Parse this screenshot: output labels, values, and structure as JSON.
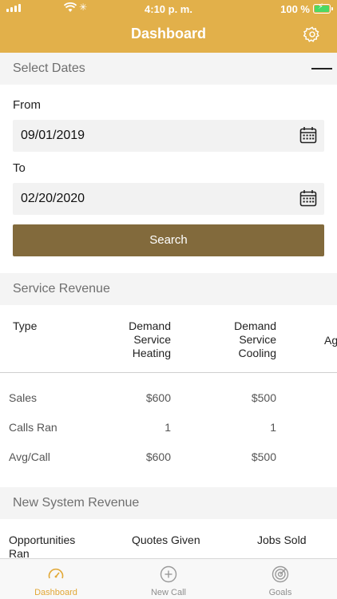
{
  "status_bar": {
    "time": "4:10 p. m.",
    "battery": "100 %"
  },
  "header": {
    "title": "Dashboard",
    "settings_icon": "gear-icon"
  },
  "select_dates": {
    "section_title": "Select Dates",
    "from_label": "From",
    "from_value": "09/01/2019",
    "to_label": "To",
    "to_value": "02/20/2020",
    "search_label": "Search"
  },
  "service_revenue": {
    "section_title": "Service Revenue",
    "columns": [
      "Type",
      "Demand\nService\nHeating",
      "Demand\nService\nCooling",
      "Ag"
    ],
    "rows": [
      {
        "label": "Sales",
        "heating": "$600",
        "cooling": "$500"
      },
      {
        "label": "Calls Ran",
        "heating": "1",
        "cooling": "1"
      },
      {
        "label": "Avg/Call",
        "heating": "$600",
        "cooling": "$500"
      }
    ]
  },
  "new_system_revenue": {
    "section_title": "New System Revenue",
    "columns": [
      "Opportunities\nRan",
      "Quotes Given",
      "Jobs Sold"
    ]
  },
  "tabbar": {
    "tabs": [
      {
        "label": "Dashboard",
        "icon": "gauge-icon",
        "active": true
      },
      {
        "label": "New Call",
        "icon": "plus-circle-icon",
        "active": false
      },
      {
        "label": "Goals",
        "icon": "target-icon",
        "active": false
      }
    ]
  },
  "colors": {
    "brand": "#e2b04a",
    "button": "#826a3c",
    "active_tab": "#e2a836"
  }
}
